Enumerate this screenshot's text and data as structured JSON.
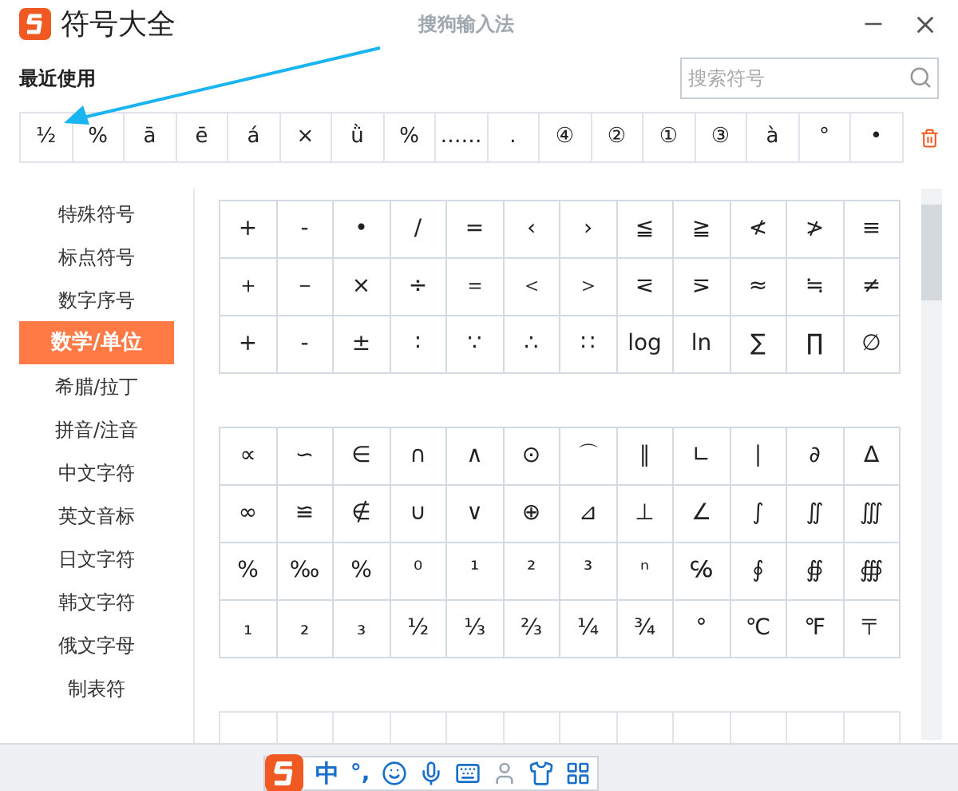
{
  "window": {
    "title": "符号大全",
    "ime_name": "搜狗输入法"
  },
  "recent": {
    "label": "最近使用",
    "symbols": [
      "½",
      "%",
      "ā",
      "ē",
      "á",
      "×",
      "ǜ",
      "%",
      "……",
      ".",
      "④",
      "②",
      "①",
      "③",
      "à",
      "°",
      "•"
    ]
  },
  "search": {
    "placeholder": "搜索符号"
  },
  "sidebar": {
    "items": [
      {
        "label": "特殊符号",
        "selected": false
      },
      {
        "label": "标点符号",
        "selected": false
      },
      {
        "label": "数字序号",
        "selected": false
      },
      {
        "label": "数学/单位",
        "selected": true
      },
      {
        "label": "希腊/拉丁",
        "selected": false
      },
      {
        "label": "拼音/注音",
        "selected": false
      },
      {
        "label": "中文字符",
        "selected": false
      },
      {
        "label": "英文音标",
        "selected": false
      },
      {
        "label": "日文字符",
        "selected": false
      },
      {
        "label": "韩文字符",
        "selected": false
      },
      {
        "label": "俄文字母",
        "selected": false
      },
      {
        "label": "制表符",
        "selected": false
      }
    ]
  },
  "symbol_grids": [
    [
      [
        "+",
        "-",
        "•",
        "/",
        "=",
        "‹",
        "›",
        "≦",
        "≧",
        "≮",
        "≯",
        "≡"
      ],
      [
        "＋",
        "－",
        "×",
        "÷",
        "＝",
        "＜",
        "＞",
        "⋜",
        "⋝",
        "≈",
        "≒",
        "≠"
      ],
      [
        "+",
        "-",
        "±",
        "∶",
        "∵",
        "∴",
        "∷",
        "log",
        "ln",
        "∑",
        "∏",
        "∅"
      ]
    ],
    [
      [
        "∝",
        "∽",
        "∈",
        "∩",
        "∧",
        "⊙",
        "⌒",
        "∥",
        "∟",
        "∣",
        "∂",
        "∆"
      ],
      [
        "∞",
        "≌",
        "∉",
        "∪",
        "∨",
        "⊕",
        "⊿",
        "⊥",
        "∠",
        "∫",
        "∬",
        "∭"
      ],
      [
        "%",
        "‰",
        "%",
        "⁰",
        "¹",
        "²",
        "³",
        "ⁿ",
        "℅",
        "∮",
        "∯",
        "∰"
      ],
      [
        "₁",
        "₂",
        "₃",
        "½",
        "⅓",
        "⅔",
        "¼",
        "¾",
        "°",
        "℃",
        "℉",
        "〒"
      ]
    ]
  ],
  "ime_toolbar": {
    "mode": "中",
    "punctuation": "°,"
  }
}
